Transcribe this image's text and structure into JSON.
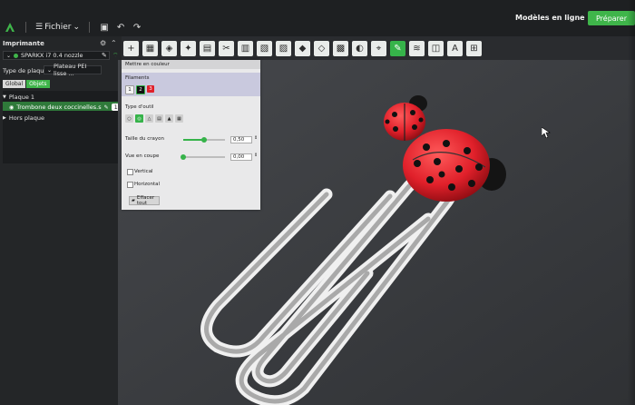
{
  "app": {
    "menu_file_label": "Fichier",
    "online_models_label": "Modèles en ligne",
    "prepare_label": "Préparer"
  },
  "sidebar": {
    "printer_section_title": "Imprimante",
    "printer_name": "SPARKX i7 0.4 nozzle",
    "plate_type_label": "Type de plaque",
    "plate_type_value": "Plateau PEI lisse ...",
    "tab_global": "Global",
    "tab_objects": "Objets",
    "plate_label": "Plaque 1",
    "object_name": "Trombone deux coccinelles.s",
    "object_count": "1",
    "off_plate_label": "Hors plaque"
  },
  "paint_panel": {
    "title": "Mettre en couleur",
    "filaments_label": "Filaments",
    "filament_1": "1",
    "filament_2": "2",
    "filament_3": "3",
    "tool_type_label": "Type d'outil",
    "pen_size_label": "Taille du crayon",
    "pen_size_value": "0,50",
    "pen_size_level": 0.5,
    "section_view_label": "Vue en coupe",
    "section_view_value": "0,00",
    "section_view_level": 0.0,
    "vertical_label": "Vertical",
    "horizontal_label": "Horizontal",
    "clear_all_label": "Effacer tout"
  },
  "colors": {
    "accent": "#36b34a",
    "ladybug_red": "#e0202a",
    "ladybug_black": "#111111",
    "clip_silver": "#d8d8d8"
  },
  "toolbar_icons": [
    "add-icon",
    "arrange-icon",
    "orient-icon",
    "auto-orient-icon",
    "slice-plate-icon",
    "cut-icon",
    "split-objects-icon",
    "split-parts-icon",
    "layer-icon",
    "support-paint-icon",
    "seam-paint-icon",
    "variable-height-icon",
    "boolean-icon",
    "measure-icon",
    "color-paint-icon",
    "fuzzy-skin-icon",
    "assembly-icon",
    "text-icon",
    "view-icon"
  ]
}
